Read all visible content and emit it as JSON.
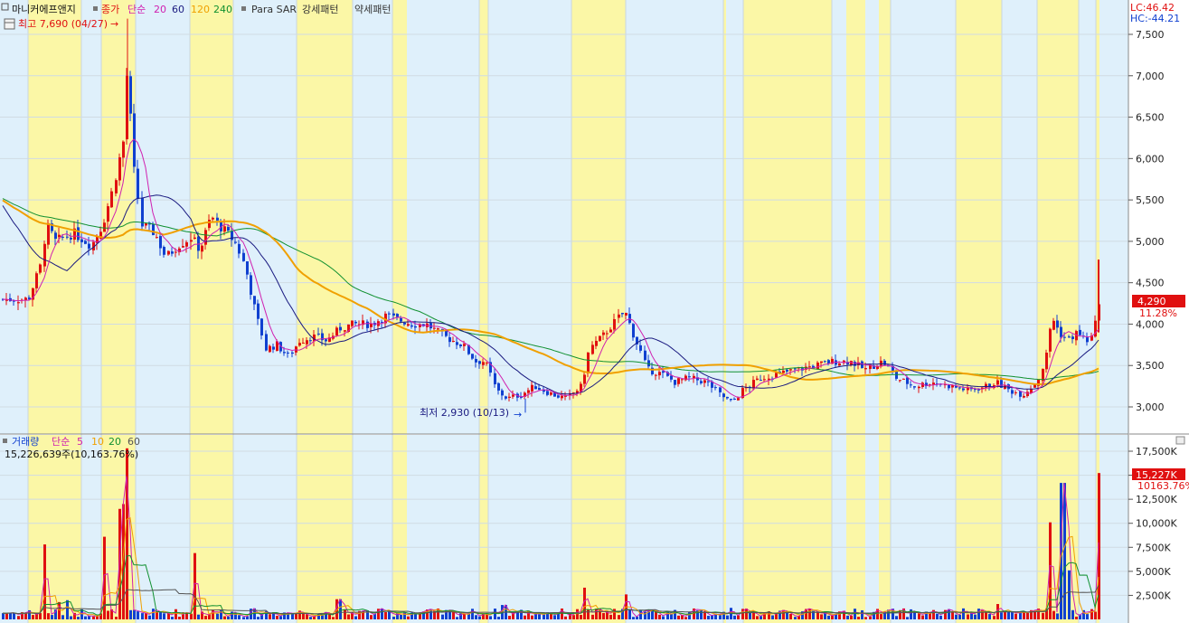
{
  "stock_name": "마니커에프앤지",
  "price_legend": {
    "close_label": "종가",
    "ma_type": "단순",
    "periods": [
      "20",
      "60",
      "120",
      "240"
    ],
    "indicator": "Para SAR",
    "strong_pattern": "강세패턴",
    "weak_pattern": "약세패턴"
  },
  "high_marker": "최고 7,690 (04/27)",
  "low_marker": "최저 2,930 (10/13)",
  "lc": "LC:46.42",
  "hc": "HC:-44.21",
  "current_price": "4,290",
  "current_change": "11.28%",
  "price_axis_ticks": [
    "7,500",
    "7,000",
    "6,500",
    "6,000",
    "5,500",
    "5,000",
    "4,500",
    "4,000",
    "3,500",
    "3,000"
  ],
  "volume_legend": {
    "label": "거래량",
    "ma_type": "단순",
    "periods": [
      "5",
      "10",
      "20",
      "60"
    ],
    "current": "15,226,639주(10,163.76%)"
  },
  "current_volume": "15,227K",
  "current_volume_ratio": "10163.76%",
  "volume_axis_ticks": [
    "17,500K",
    "15,000K",
    "12,500K",
    "10,000K",
    "7,500K",
    "5,000K",
    "2,500K"
  ],
  "colors": {
    "up": "#e01010",
    "down": "#1040d0",
    "ma20": "#d020b0",
    "ma60": "#1a1a80",
    "ma120": "#f0a000",
    "ma240": "#109030",
    "strong_band": "#fbf7a6",
    "weak_band": "#dff0fb"
  },
  "chart_data": {
    "type": "candlestick",
    "ylim": [
      2750,
      7700
    ],
    "volume_ylim": [
      0,
      18000000
    ],
    "high": 7690,
    "low": 2930,
    "last_close": 4290
  }
}
